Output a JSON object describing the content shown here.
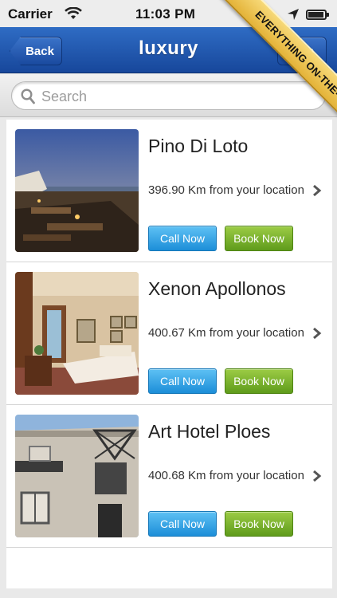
{
  "status_bar": {
    "carrier": "Carrier",
    "time": "11:03 PM"
  },
  "nav": {
    "back_label": "Back",
    "title": "Luxury",
    "right_label": "Map"
  },
  "ribbon": {
    "text": "EVERYTHING ON-THE-GO"
  },
  "search": {
    "placeholder": "Search"
  },
  "buttons": {
    "call_label": "Call Now",
    "book_label": "Book Now"
  },
  "colors": {
    "nav_blue": "#1f54aa",
    "call_blue": "#2b9fe6",
    "book_green": "#78b02e",
    "ribbon_gold": "#eec24f"
  },
  "hotels": [
    {
      "name": "Pino Di Loto",
      "distance": "396.90 Km from your location"
    },
    {
      "name": "Xenon Apollonos",
      "distance": "400.67 Km from your location"
    },
    {
      "name": "Art Hotel Ploes",
      "distance": "400.68 Km from your location"
    }
  ]
}
